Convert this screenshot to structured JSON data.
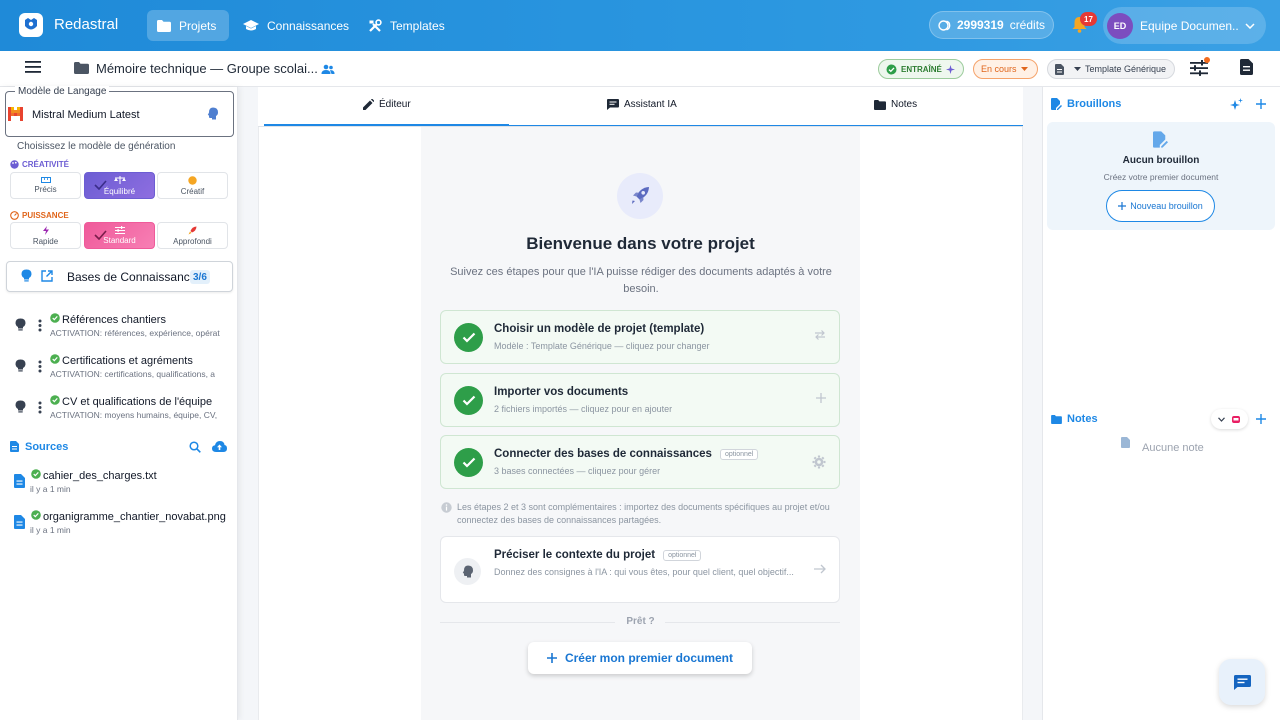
{
  "app": {
    "name": "Redastral"
  },
  "nav": {
    "items": [
      {
        "label": "Projets",
        "icon": "folder-icon",
        "active": true
      },
      {
        "label": "Connaissances",
        "icon": "graduation-cap-icon",
        "active": false
      },
      {
        "label": "Templates",
        "icon": "tools-icon",
        "active": false
      }
    ],
    "credits_value": "2999319",
    "credits_label": "crédits",
    "notifications_count": "17",
    "account_initials": "ED",
    "account_name": "Equipe Documen..."
  },
  "subheader": {
    "project_title": "Mémoire technique — Groupe scolai...",
    "trained_badge": "ENTRAÎNÉ",
    "status": "En cours",
    "template": "Template Générique"
  },
  "left": {
    "model_legend": "Modèle de Langage",
    "model_value": "Mistral Medium Latest",
    "hint": "Choisissez le modèle de génération",
    "creativity": {
      "label": "CRÉATIVITÉ",
      "options": [
        "Précis",
        "Équilibré",
        "Créatif"
      ],
      "selected": "Équilibré"
    },
    "power": {
      "label": "PUISSANCE",
      "options": [
        "Rapide",
        "Standard",
        "Approfondi"
      ],
      "selected": "Standard"
    },
    "kb_label": "Bases de Connaissance",
    "kb_count": "3/6",
    "kb_items": [
      {
        "title": "Références chantiers",
        "sub": "ACTIVATION: références, expérience, opérat"
      },
      {
        "title": "Certifications et agréments",
        "sub": "ACTIVATION: certifications, qualifications, a"
      },
      {
        "title": "CV et qualifications de l'équipe",
        "sub": "ACTIVATION: moyens humains, équipe, CV,"
      }
    ],
    "sources_title": "Sources",
    "sources": [
      {
        "name": "cahier_des_charges.txt",
        "time": "il y a 1 min"
      },
      {
        "name": "organigramme_chantier_novabat.png",
        "time": "il y a 1 min"
      }
    ]
  },
  "center": {
    "tabs": [
      {
        "label": "Éditeur",
        "icon": "pencil-icon"
      },
      {
        "label": "Assistant IA",
        "icon": "chat-icon"
      },
      {
        "label": "Notes",
        "icon": "folder-icon"
      }
    ],
    "welcome_title": "Bienvenue dans votre projet",
    "welcome_sub": "Suivez ces étapes pour que l'IA puisse rédiger des documents adaptés à votre besoin.",
    "steps": [
      {
        "title": "Choisir un modèle de projet (template)",
        "sub": "Modèle : Template Générique — cliquez pour changer",
        "optional": ""
      },
      {
        "title": "Importer vos documents",
        "sub": "2 fichiers importés — cliquez pour en ajouter",
        "optional": ""
      },
      {
        "title": "Connecter des bases de connaissances",
        "sub": "3 bases connectées — cliquez pour gérer",
        "optional": "optionnel"
      }
    ],
    "info": "Les étapes 2 et 3 sont complémentaires : importez des documents spécifiques au projet et/ou connectez des bases de connaissances partagées.",
    "context_step": {
      "title": "Préciser le contexte du projet",
      "optional": "optionnel",
      "sub": "Donnez des consignes à l'IA : qui vous êtes, pour quel client, quel objectif..."
    },
    "ready": "Prêt ?",
    "create_button": "Créer mon premier document"
  },
  "right": {
    "drafts_title": "Brouillons",
    "drafts_empty": "Aucun brouillon",
    "drafts_empty_sub": "Créez votre premier document",
    "new_draft": "Nouveau brouillon",
    "notes_title": "Notes",
    "notes_empty": "Aucune note"
  },
  "colors": {
    "primary": "#1e88e5",
    "success": "#2e9e49",
    "purple": "#6c5dd3",
    "pink": "#ef5a9a",
    "orange": "#e0651b"
  }
}
